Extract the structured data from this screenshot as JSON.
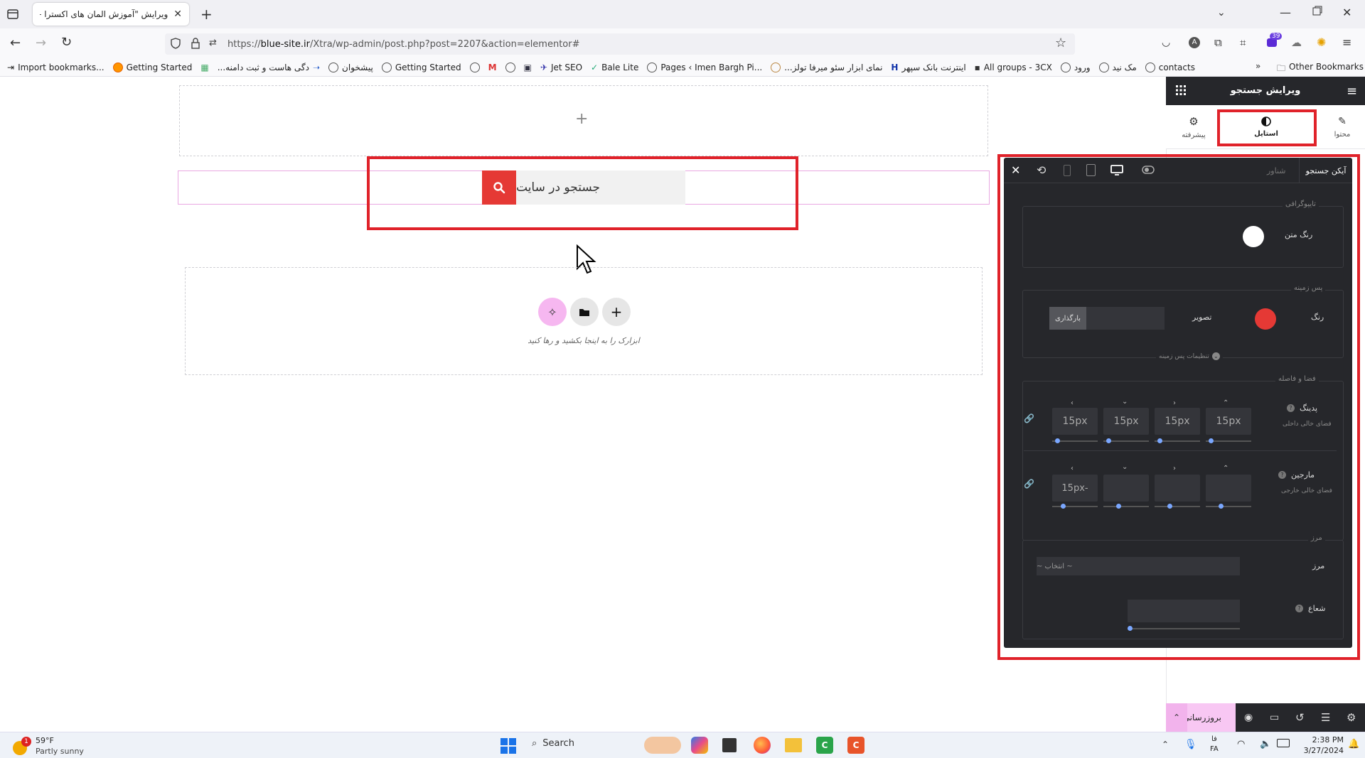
{
  "browser": {
    "tab_title": "ویرایش \"آموزش المان های اکسترا – ع",
    "url_prefix": "https://",
    "url_domain": "blue-site.ir",
    "url_path": "/Xtra/wp-admin/post.php?post=2207&action=elementor#",
    "notification_badge": "39",
    "bookmarks": [
      {
        "label": "Import bookmarks...",
        "icon": "import-icon"
      },
      {
        "label": "Getting Started",
        "icon": "firefox-icon"
      },
      {
        "label": "دگی هاست و ثبت دامنه...",
        "icon": "site-icon"
      },
      {
        "label": "پیشخوان",
        "icon": "wordpress-icon"
      },
      {
        "label": "Getting Started",
        "icon": "globe-icon"
      },
      {
        "label": "Jet SEO",
        "icon": "jet-icon"
      },
      {
        "label": "Bale Lite",
        "icon": "bale-icon"
      },
      {
        "label": "Pages ‹ Imen Bargh Pi...",
        "icon": "globe-icon"
      },
      {
        "label": "...نمای ابزار سئو میرفا تولز",
        "icon": "seo-icon"
      },
      {
        "label": "اینترنت بانک سپهر",
        "icon": "bank-icon"
      },
      {
        "label": "All groups - 3CX",
        "icon": "3cx-icon"
      },
      {
        "label": "ورود",
        "icon": "globe-icon"
      },
      {
        "label": "مک نید",
        "icon": "globe-icon"
      },
      {
        "label": "contacts",
        "icon": "globe-icon"
      }
    ],
    "other_bookmarks": "Other Bookmarks"
  },
  "canvas": {
    "search_placeholder": "جستجو در سایت",
    "drop_hint": "ابزارک را به اینجا بکشید و رها کنید"
  },
  "panel": {
    "title": "ویرایش جستجو",
    "tabs": [
      {
        "label": "محتوا",
        "icon": "pencil-icon"
      },
      {
        "label": "استایل",
        "icon": "contrast-icon"
      },
      {
        "label": "پیشرفته",
        "icon": "gear-icon"
      }
    ],
    "update_label": "بروزرسانی"
  },
  "style_panel": {
    "header_title": "آیکن جستجو",
    "header_sub": "شناور",
    "typography_title": "تایپوگرافی",
    "text_color_label": "رنگ متن",
    "background_title": "پس زمینه",
    "color_label": "رنگ",
    "image_label": "تصویر",
    "upload_label": "بارگذاری",
    "background_settings": "تنظیمات پس زمینه",
    "spacing_title": "فضا و فاصله",
    "padding_label": "پدینگ",
    "padding_sub": "فضای خالی داخلی",
    "padding_values": [
      "15px",
      "15px",
      "15px",
      "15px"
    ],
    "margin_label": "مارجین",
    "margin_sub": "فضای خالی خارجی",
    "margin_values": [
      "15px-",
      "",
      "",
      ""
    ],
    "border_title": "مرز",
    "border_label": "مرز",
    "border_select": "~ انتخاب ~",
    "radius_label": "شعاع",
    "colors": {
      "text_color": "#ffffff",
      "bg_color": "#e53935"
    }
  },
  "taskbar": {
    "weather_temp": "59°F",
    "weather_desc": "Partly sunny",
    "weather_badge": "1",
    "search": "Search",
    "lang_top": "فا",
    "lang_bottom": "FA",
    "time": "2:38 PM",
    "date": "3/27/2024"
  }
}
